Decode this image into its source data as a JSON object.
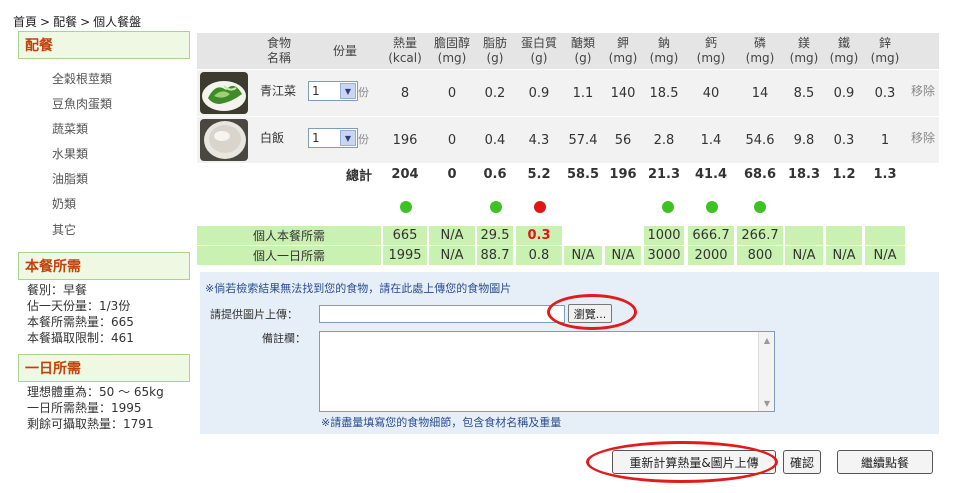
{
  "breadcrumb": [
    "首頁",
    "配餐",
    "個人餐盤"
  ],
  "sidebar": {
    "meal_header": "配餐",
    "categories": [
      "全穀根莖類",
      "豆魚肉蛋類",
      "蔬菜類",
      "水果類",
      "油脂類",
      "奶類",
      "其它"
    ],
    "meal_req_header": "本餐所需",
    "meal_info": [
      "餐別：早餐",
      "佔一天份量：1/3份",
      "本餐所需熱量：665",
      "本餐攝取限制：461"
    ],
    "day_req_header": "一日所需",
    "day_info": [
      "理想體重為：50 ～ 65kg",
      "一日所需熱量：1995",
      "剩餘可攝取熱量：1791"
    ]
  },
  "table": {
    "headers": [
      {
        "top": "食物",
        "bottom": "名稱"
      },
      {
        "top": "份量",
        "bottom": ""
      },
      {
        "top": "熱量",
        "bottom": "(kcal)"
      },
      {
        "top": "膽固醇",
        "bottom": "(mg)"
      },
      {
        "top": "脂肪",
        "bottom": "(g)"
      },
      {
        "top": "蛋白質",
        "bottom": "(g)"
      },
      {
        "top": "醣類",
        "bottom": "(g)"
      },
      {
        "top": "鉀",
        "bottom": "(mg)"
      },
      {
        "top": "鈉",
        "bottom": "(mg)"
      },
      {
        "top": "鈣",
        "bottom": "(mg)"
      },
      {
        "top": "磷",
        "bottom": "(mg)"
      },
      {
        "top": "鎂",
        "bottom": "(mg)"
      },
      {
        "top": "鐵",
        "bottom": "(mg)"
      },
      {
        "top": "鋅",
        "bottom": "(mg)"
      }
    ],
    "rows": [
      {
        "image": "green-vegetable-dish",
        "name": "青江菜",
        "qty": "1",
        "unit": "份",
        "values": [
          "8",
          "0",
          "0.2",
          "0.9",
          "1.1",
          "140",
          "18.5",
          "40",
          "14",
          "8.5",
          "0.9",
          "0.3"
        ],
        "remove": "移除"
      },
      {
        "image": "white-rice-bowl",
        "name": "白飯",
        "qty": "1",
        "unit": "份",
        "values": [
          "196",
          "0",
          "0.4",
          "4.3",
          "57.4",
          "56",
          "2.8",
          "1.4",
          "54.6",
          "9.8",
          "0.3",
          "1"
        ],
        "remove": "移除"
      }
    ],
    "total_label": "總計",
    "totals": [
      "204",
      "0",
      "0.6",
      "5.2",
      "58.5",
      "196",
      "21.3",
      "41.4",
      "68.6",
      "18.3",
      "1.2",
      "1.3"
    ],
    "indicators": [
      "green",
      "",
      "green",
      "red",
      "",
      "",
      "green",
      "green",
      "green",
      "",
      "",
      ""
    ],
    "indicator_colors": {
      "green": "#3cc223",
      "red": "#e01515"
    },
    "meal_req_label": "個人本餐所需",
    "meal_req": [
      "665",
      "N/A",
      "29.5",
      "0.3",
      "",
      "",
      "1000",
      "666.7",
      "266.7",
      "",
      "",
      ""
    ],
    "meal_req_alert_index": 3,
    "day_req_label": "個人一日所需",
    "day_req": [
      "1995",
      "N/A",
      "88.7",
      "0.8",
      "N/A",
      "N/A",
      "3000",
      "2000",
      "800",
      "N/A",
      "N/A",
      "N/A"
    ]
  },
  "upload": {
    "note": "※倘若檢索結果無法找到您的食物，請在此處上傳您的食物圖片",
    "image_label": "請提供圖片上傳：",
    "browse_label": "瀏覽...",
    "notes_label": "備註欄：",
    "notes_hint": "※請盡量填寫您的食物細節，包含食材名稱及重量"
  },
  "buttons": {
    "recalc": "重新計算熱量&圖片上傳",
    "confirm": "確認",
    "continue": "繼續點餐"
  },
  "colors": {
    "highlight_ellipse": "#e21a1a",
    "req_row_bg": "#c9f2b2",
    "sidebar_header_text": "#c2410c"
  }
}
